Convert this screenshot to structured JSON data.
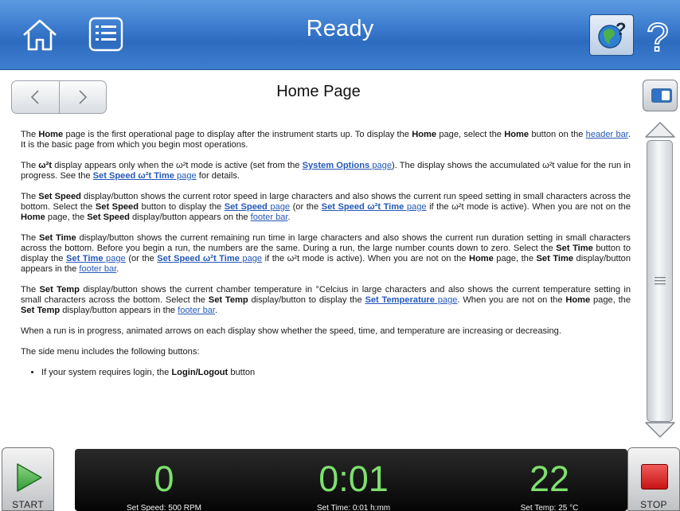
{
  "header": {
    "title": "Ready",
    "help_glyph": "?",
    "icons": [
      "home-icon",
      "list-icon",
      "globe-help-icon",
      "question-mark-icon"
    ]
  },
  "content": {
    "page_title": "Home Page",
    "paragraphs": [
      [
        {
          "t": "The "
        },
        {
          "t": "Home",
          "b": true
        },
        {
          "t": " page is the first operational page to display after the instrument starts up. To display the "
        },
        {
          "t": "Home",
          "b": true
        },
        {
          "t": " page, select the "
        },
        {
          "t": "Home",
          "b": true
        },
        {
          "t": " button on the "
        },
        {
          "t": "header bar",
          "link": true
        },
        {
          "t": ". It is the basic page from which you begin most operations."
        }
      ],
      [
        {
          "t": "The "
        },
        {
          "t": "ω²t",
          "b": true
        },
        {
          "t": " display appears only when the ω²t mode is active (set from the "
        },
        {
          "t": "System Options",
          "link": true,
          "b": true
        },
        {
          "t": " page",
          "link": true
        },
        {
          "t": "). The display shows the accumulated ω²t value for the run in progress. See the "
        },
        {
          "t": "Set Speed ω²t Time",
          "link": true,
          "b": true
        },
        {
          "t": " page",
          "link": true
        },
        {
          "t": " for details."
        }
      ],
      [
        {
          "t": "The "
        },
        {
          "t": "Set Speed",
          "b": true
        },
        {
          "t": " display/button shows the current rotor speed in large characters and also shows the current run speed setting in small characters across the bottom. Select the "
        },
        {
          "t": "Set Speed",
          "b": true
        },
        {
          "t": " button to display the "
        },
        {
          "t": "Set Speed",
          "link": true,
          "b": true
        },
        {
          "t": " page",
          "link": true
        },
        {
          "t": " (or the "
        },
        {
          "t": "Set Speed ω²t Time",
          "link": true,
          "b": true
        },
        {
          "t": " page",
          "link": true
        },
        {
          "t": " if the ω²t mode is active). When you are not on the "
        },
        {
          "t": "Home",
          "b": true
        },
        {
          "t": " page, the "
        },
        {
          "t": "Set Speed",
          "b": true
        },
        {
          "t": " display/button appears on the "
        },
        {
          "t": "footer bar",
          "link": true
        },
        {
          "t": "."
        }
      ],
      [
        {
          "t": "The "
        },
        {
          "t": "Set Time",
          "b": true
        },
        {
          "t": " display/button shows the current remaining run time in large characters and also shows the current run duration setting in small characters across the bottom. Before you begin a run, the numbers are the same. During a run, the large number counts down to zero. Select the "
        },
        {
          "t": "Set Time",
          "b": true
        },
        {
          "t": " button to display the "
        },
        {
          "t": "Set Time",
          "link": true,
          "b": true
        },
        {
          "t": " page",
          "link": true
        },
        {
          "t": " (or the "
        },
        {
          "t": "Set Speed ω²t Time",
          "link": true,
          "b": true
        },
        {
          "t": " page",
          "link": true
        },
        {
          "t": " if the ω²t mode is active). When you are not on the "
        },
        {
          "t": "Home",
          "b": true
        },
        {
          "t": " page, the "
        },
        {
          "t": "Set Time",
          "b": true
        },
        {
          "t": " display/button appears in the "
        },
        {
          "t": "footer bar",
          "link": true
        },
        {
          "t": "."
        }
      ],
      [
        {
          "t": "The "
        },
        {
          "t": "Set Temp",
          "b": true
        },
        {
          "t": " display/button shows the current chamber temperature in °Celcius in large characters and also shows the current temperature setting in small characters across the bottom. Select the "
        },
        {
          "t": "Set Temp",
          "b": true
        },
        {
          "t": " display/button to display the "
        },
        {
          "t": "Set Temperature",
          "link": true,
          "b": true
        },
        {
          "t": " page",
          "link": true
        },
        {
          "t": ". When you are not on the "
        },
        {
          "t": "Home",
          "b": true
        },
        {
          "t": " page, the "
        },
        {
          "t": "Set Temp",
          "b": true
        },
        {
          "t": " display/button appears in the "
        },
        {
          "t": "footer bar",
          "link": true
        },
        {
          "t": "."
        }
      ],
      [
        {
          "t": "When a run is in progress, animated arrows on each display show whether the speed, time, and temperature are increasing or decreasing."
        }
      ],
      [
        {
          "t": "The side menu includes the following buttons:"
        }
      ]
    ],
    "list_items": [
      [
        {
          "t": "If your system requires login, the "
        },
        {
          "t": "Login/Logout",
          "b": true
        },
        {
          "t": " button"
        }
      ]
    ]
  },
  "footer": {
    "start_label": "START",
    "stop_label": "STOP",
    "speed": {
      "value": "0",
      "setting": "Set Speed: 500 RPM"
    },
    "time": {
      "value": "0:01",
      "setting": "Set Time: 0:01 h:mm"
    },
    "temp": {
      "value": "22",
      "setting": "Set Temp: 25 °C"
    }
  },
  "colors": {
    "header_blue": "#3f7fd0",
    "link_blue": "#2458b8",
    "readout_green": "#7ee06d",
    "stop_red": "#d42020",
    "start_green": "#49b045"
  }
}
